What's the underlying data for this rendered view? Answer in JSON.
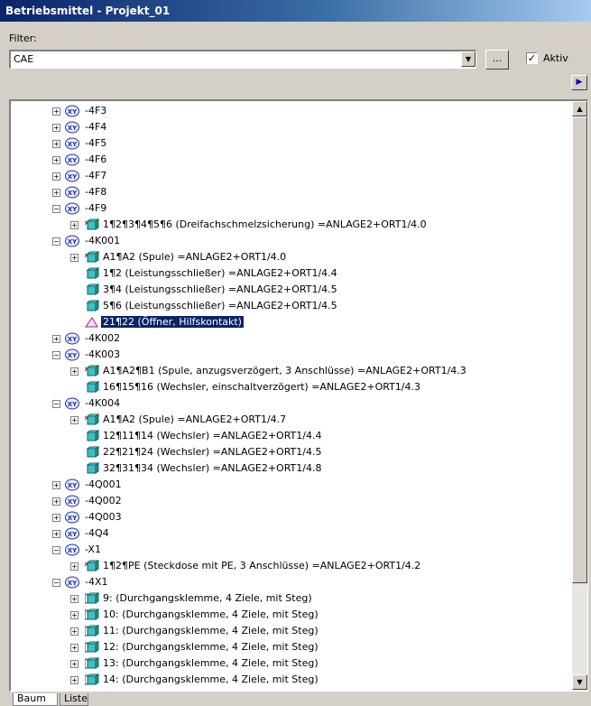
{
  "window": {
    "title": "Betriebsmittel - Projekt_01"
  },
  "filter": {
    "label": "Filter:",
    "value": "CAE",
    "more_label": "...",
    "aktiv_checked": true,
    "aktiv_label": "Aktiv"
  },
  "tabs": [
    {
      "label": "Baum",
      "active": true
    },
    {
      "label": "Liste",
      "active": false
    }
  ],
  "tree_rows": [
    {
      "level": 0,
      "icon": "device-xy-icon",
      "text": "-4F3",
      "expander": "+"
    },
    {
      "level": 0,
      "icon": "device-xy-icon",
      "text": "-4F4",
      "expander": "+"
    },
    {
      "level": 0,
      "icon": "device-xy-icon",
      "text": "-4F5",
      "expander": "+"
    },
    {
      "level": 0,
      "icon": "device-xy-icon",
      "text": "-4F6",
      "expander": "+"
    },
    {
      "level": 0,
      "icon": "device-xy-icon",
      "text": "-4F7",
      "expander": "+"
    },
    {
      "level": 0,
      "icon": "device-xy-icon",
      "text": "-4F8",
      "expander": "+"
    },
    {
      "level": 0,
      "icon": "device-xy-icon",
      "text": "-4F9",
      "expander": "-"
    },
    {
      "level": 1,
      "icon": "fuse-component-icon",
      "text": "1¶2¶3¶4¶5¶6 (Dreifachschmelzsicherung) =ANLAGE2+ORT1/4.0",
      "expander": "+"
    },
    {
      "level": 0,
      "icon": "device-xy-icon",
      "text": "-4K001",
      "expander": "-"
    },
    {
      "level": 1,
      "icon": "coil-component-icon",
      "text": "A1¶A2 (Spule) =ANLAGE2+ORT1/4.0",
      "expander": "+"
    },
    {
      "level": 1,
      "icon": "contact-component-icon",
      "text": "1¶2 (Leistungsschließer) =ANLAGE2+ORT1/4.4",
      "expander": ""
    },
    {
      "level": 1,
      "icon": "contact-component-icon",
      "text": "3¶4 (Leistungsschließer) =ANLAGE2+ORT1/4.5",
      "expander": ""
    },
    {
      "level": 1,
      "icon": "contact-component-icon",
      "text": "5¶6 (Leistungsschließer) =ANLAGE2+ORT1/4.5",
      "expander": ""
    },
    {
      "level": 1,
      "icon": "nc-contact-icon",
      "text": "21¶22 (Öffner, Hilfskontakt)",
      "expander": "",
      "selected": true
    },
    {
      "level": 0,
      "icon": "device-xy-icon",
      "text": "-4K002",
      "expander": "+"
    },
    {
      "level": 0,
      "icon": "device-xy-icon",
      "text": "-4K003",
      "expander": "-"
    },
    {
      "level": 1,
      "icon": "coil-component-icon",
      "text": "A1¶A2¶B1 (Spule, anzugsverzögert, 3 Anschlüsse) =ANLAGE2+ORT1/4.3",
      "expander": "+"
    },
    {
      "level": 1,
      "icon": "contact-component-icon",
      "text": "16¶15¶16 (Wechsler, einschaltverzögert) =ANLAGE2+ORT1/4.3",
      "expander": ""
    },
    {
      "level": 0,
      "icon": "device-xy-icon",
      "text": "-4K004",
      "expander": "-"
    },
    {
      "level": 1,
      "icon": "coil-component-icon",
      "text": "A1¶A2 (Spule) =ANLAGE2+ORT1/4.7",
      "expander": "+"
    },
    {
      "level": 1,
      "icon": "contact-component-icon",
      "text": "12¶11¶14 (Wechsler) =ANLAGE2+ORT1/4.4",
      "expander": ""
    },
    {
      "level": 1,
      "icon": "contact-component-icon",
      "text": "22¶21¶24 (Wechsler) =ANLAGE2+ORT1/4.5",
      "expander": ""
    },
    {
      "level": 1,
      "icon": "contact-component-icon",
      "text": "32¶31¶34 (Wechsler) =ANLAGE2+ORT1/4.8",
      "expander": ""
    },
    {
      "level": 0,
      "icon": "device-xy-icon",
      "text": "-4Q001",
      "expander": "+"
    },
    {
      "level": 0,
      "icon": "device-xy-icon",
      "text": "-4Q002",
      "expander": "+"
    },
    {
      "level": 0,
      "icon": "device-xy-icon",
      "text": "-4Q003",
      "expander": "+"
    },
    {
      "level": 0,
      "icon": "device-xy-icon",
      "text": "-4Q4",
      "expander": "+"
    },
    {
      "level": 0,
      "icon": "device-xy-icon",
      "text": "-X1",
      "expander": "-"
    },
    {
      "level": 1,
      "icon": "socket-component-icon",
      "text": "1¶2¶PE (Steckdose mit PE, 3 Anschlüsse) =ANLAGE2+ORT1/4.2",
      "expander": "+"
    },
    {
      "level": 0,
      "icon": "device-xy-icon",
      "text": "-4X1",
      "expander": "-"
    },
    {
      "level": 1,
      "icon": "terminal-component-icon",
      "text": "9: (Durchgangsklemme, 4 Ziele, mit Steg)",
      "expander": "+"
    },
    {
      "level": 1,
      "icon": "terminal-component-icon",
      "text": "10: (Durchgangsklemme, 4 Ziele, mit Steg)",
      "expander": "+"
    },
    {
      "level": 1,
      "icon": "terminal-component-icon",
      "text": "11: (Durchgangsklemme, 4 Ziele, mit Steg)",
      "expander": "+"
    },
    {
      "level": 1,
      "icon": "terminal-component-icon",
      "text": "12: (Durchgangsklemme, 4 Ziele, mit Steg)",
      "expander": "+"
    },
    {
      "level": 1,
      "icon": "terminal-component-icon",
      "text": "13: (Durchgangsklemme, 4 Ziele, mit Steg)",
      "expander": "+"
    },
    {
      "level": 1,
      "icon": "terminal-component-icon",
      "text": "14: (Durchgangsklemme, 4 Ziele, mit Steg)",
      "expander": "+"
    }
  ]
}
